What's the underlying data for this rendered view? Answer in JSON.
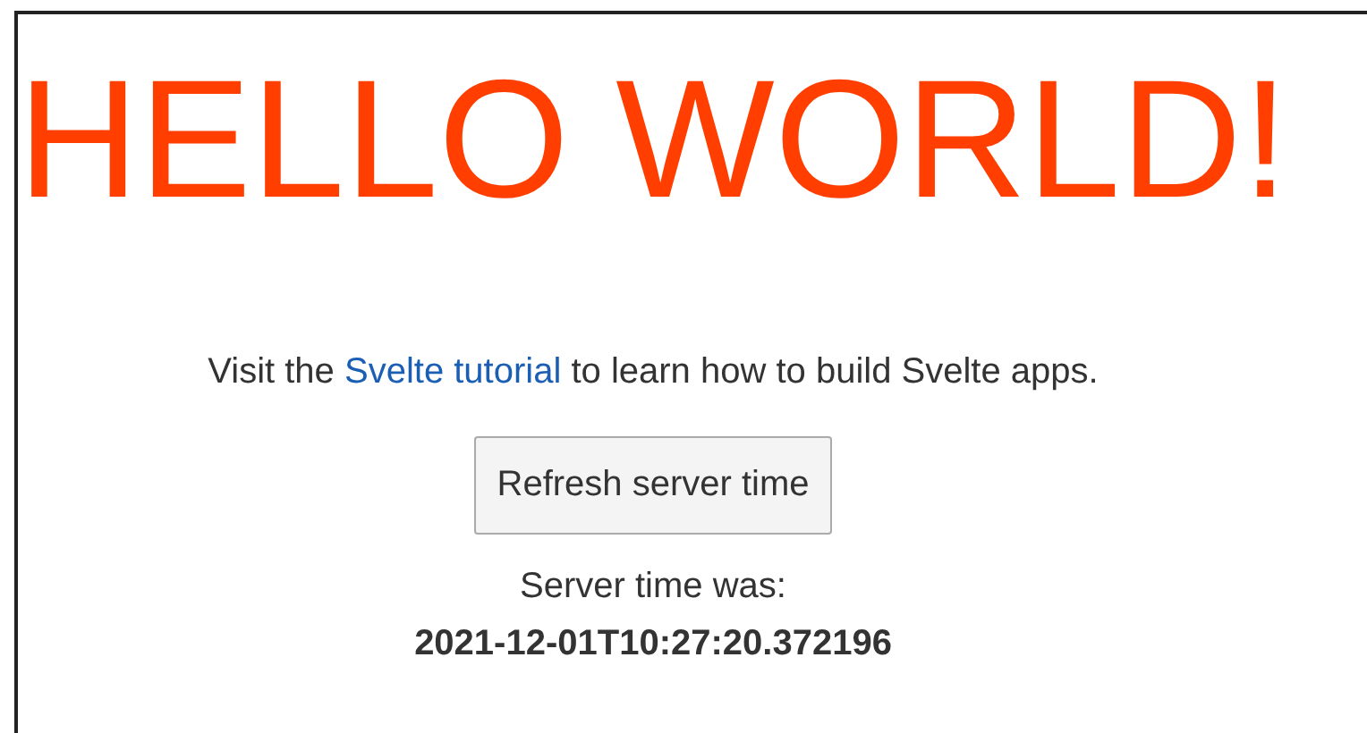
{
  "heading": "HELLO WORLD!",
  "intro": {
    "before": "Visit the",
    "link": "Svelte tutorial",
    "after": "to learn how to build Svelte apps."
  },
  "button": {
    "label": "Refresh server time"
  },
  "server_time": {
    "label": "Server time was:",
    "value": "2021-12-01T10:27:20.372196"
  }
}
